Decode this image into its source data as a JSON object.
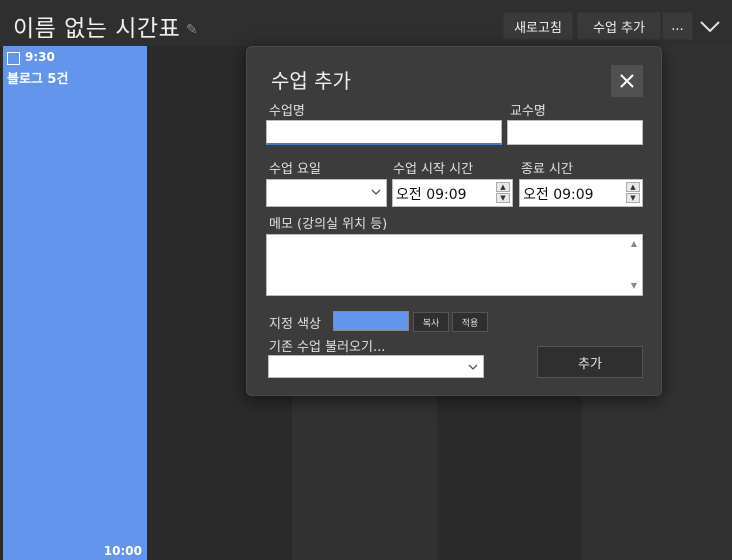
{
  "window": {
    "title": "이름 없는 시간표"
  },
  "toolbar": {
    "refresh_label": "새로고침",
    "add_class_label": "수업 추가",
    "more_label": "..."
  },
  "timetable": {
    "event": {
      "time": "9:30",
      "title": "블로그 5건",
      "end_time": "10:00",
      "color": "#6495ed"
    }
  },
  "dialog": {
    "title": "수업 추가",
    "class_name_label": "수업명",
    "class_name_value": "",
    "professor_label": "교수명",
    "professor_value": "",
    "day_label": "수업 요일",
    "day_value": "",
    "start_label": "수업 시작 시간",
    "start_value": "오전 09:09",
    "end_label": "종료 시간",
    "end_value": "오전 09:09",
    "memo_label": "메모 (강의실 위치 등)",
    "memo_value": "",
    "color_label": "지정 색상",
    "color_value": "#6495ed",
    "copy_label": "복사",
    "apply_label": "적용",
    "load_label": "기존 수업 불러오기...",
    "load_value": "",
    "add_button": "추가"
  },
  "colors": {
    "background": "#2b2b2b",
    "dialog": "#3c3c3c",
    "accent": "#6495ed"
  }
}
